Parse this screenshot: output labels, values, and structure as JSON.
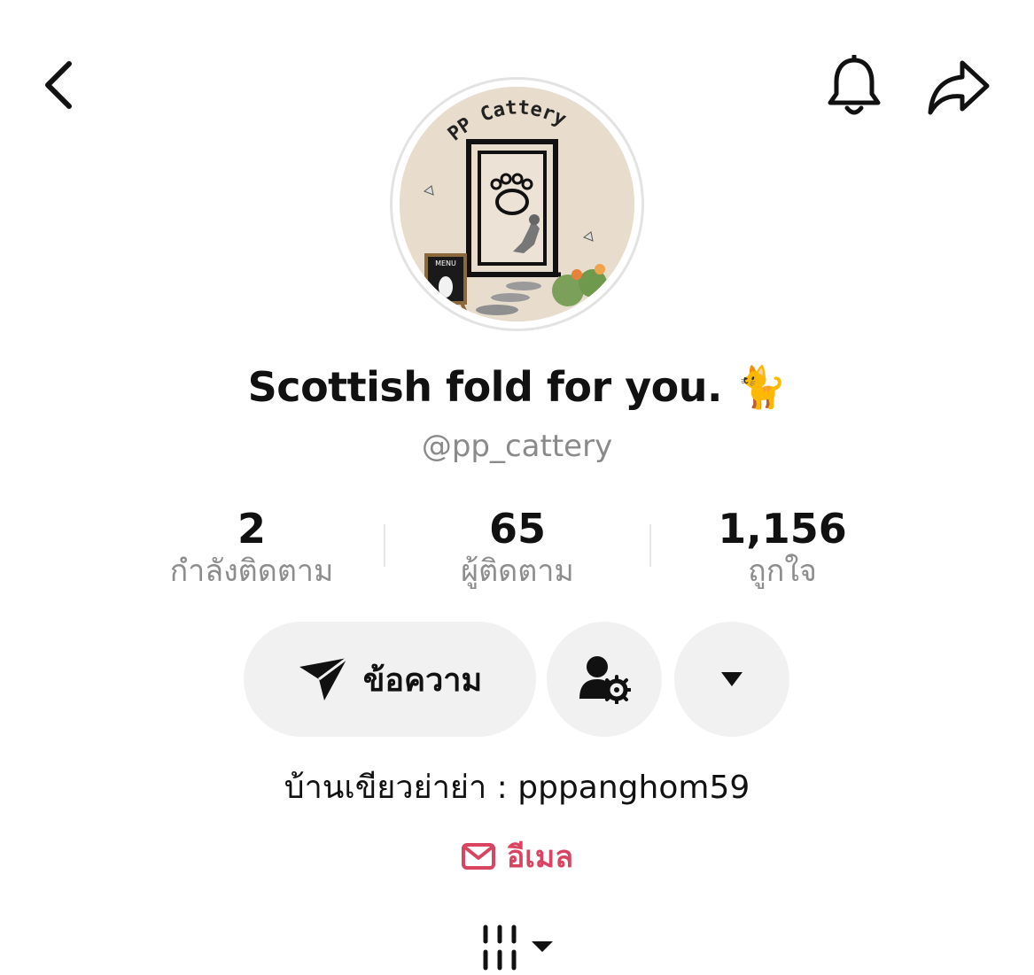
{
  "profile": {
    "display_name": "Scottish fold for you. 🐈",
    "handle": "@pp_cattery",
    "avatar_logo_text": "PP Cattery",
    "avatar_menu_text": "MENU"
  },
  "stats": [
    {
      "value": "2",
      "label": "กำลังติดตาม"
    },
    {
      "value": "65",
      "label": "ผู้ติดตาม"
    },
    {
      "value": "1,156",
      "label": "ถูกใจ"
    }
  ],
  "actions": {
    "message_label": "ข้อความ"
  },
  "bio": "บ้านเขียวย่าย่า : pppanghom59",
  "email_label": "อีเมล",
  "colors": {
    "accent_email": "#d94560",
    "button_bg": "#f1f1f1",
    "secondary_text": "#8d8d8d"
  },
  "icons": {
    "back": "chevron-left-icon",
    "bell": "bell-icon",
    "share": "share-arrow-icon",
    "send": "send-icon",
    "user_settings": "user-gear-icon",
    "more": "triangle-down-icon",
    "email": "mail-icon",
    "tabs": "grid-lines-icon"
  }
}
